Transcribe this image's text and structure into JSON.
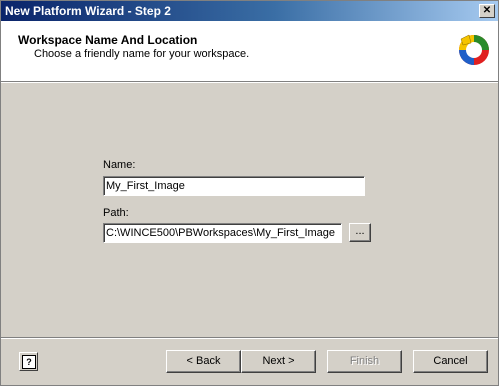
{
  "window": {
    "title": "New Platform Wizard - Step 2",
    "close_glyph": "✕"
  },
  "header": {
    "title": "Workspace Name And Location",
    "subtitle": "Choose a friendly name for your workspace.",
    "logo_icon": "platform-builder-logo"
  },
  "form": {
    "name_label": "Name:",
    "name_value": "My_First_Image",
    "path_label": "Path:",
    "path_value": "C:\\WINCE500\\PBWorkspaces\\My_First_Image",
    "browse_label": "..."
  },
  "footer": {
    "help_glyph": "?",
    "back_label": "< Back",
    "next_label": "Next >",
    "finish_label": "Finish",
    "cancel_label": "Cancel"
  },
  "colors": {
    "titlebar_start": "#0a246a",
    "titlebar_end": "#a6caf0",
    "dialog_bg": "#d4d0c8"
  }
}
